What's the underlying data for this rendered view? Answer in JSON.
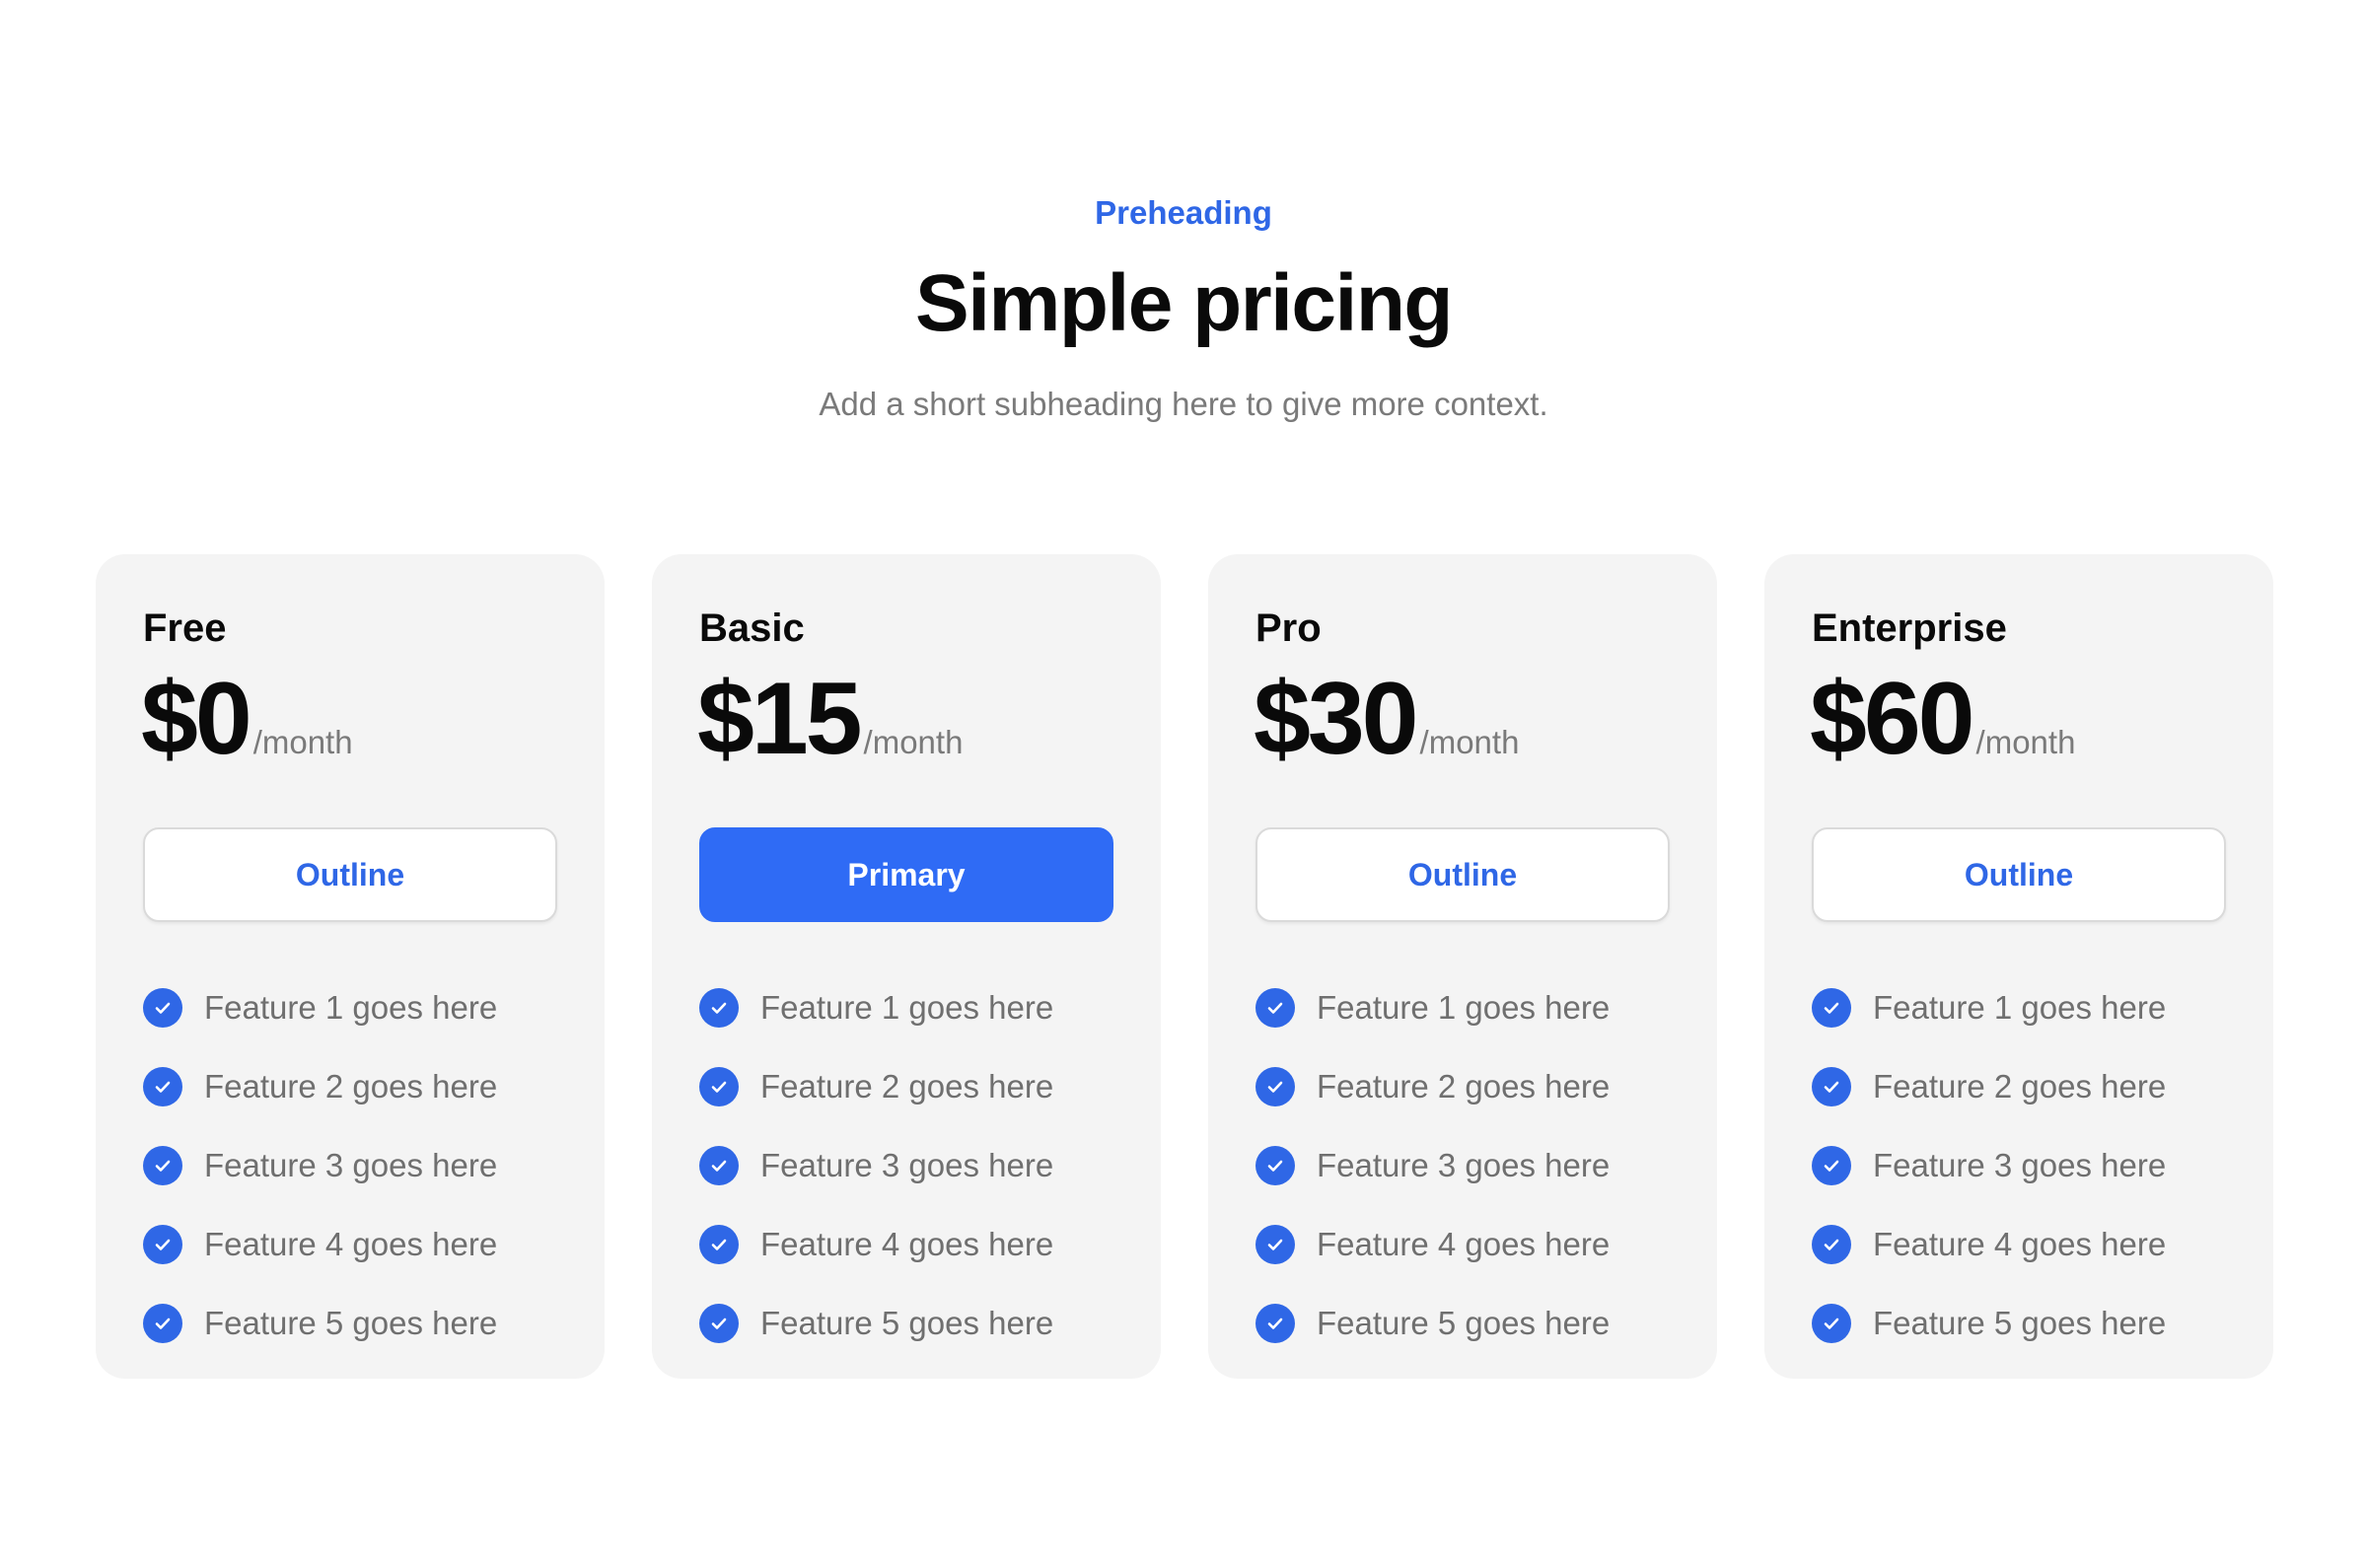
{
  "header": {
    "preheading": "Preheading",
    "title": "Simple pricing",
    "subheading": "Add a short subheading here to give more context."
  },
  "colors": {
    "accent": "#2f67e6",
    "primary_button": "#2f6bf5",
    "card_background": "#f4f4f4",
    "muted_text": "#7a7a7a"
  },
  "plans": [
    {
      "name": "Free",
      "price": "$0",
      "period": "/month",
      "button_label": "Outline",
      "button_style": "outline",
      "features": [
        "Feature 1 goes here",
        "Feature 2 goes here",
        "Feature 3 goes here",
        "Feature 4 goes here",
        "Feature 5 goes here"
      ]
    },
    {
      "name": "Basic",
      "price": "$15",
      "period": "/month",
      "button_label": "Primary",
      "button_style": "primary",
      "features": [
        "Feature 1 goes here",
        "Feature 2 goes here",
        "Feature 3 goes here",
        "Feature 4 goes here",
        "Feature 5 goes here"
      ]
    },
    {
      "name": "Pro",
      "price": "$30",
      "period": "/month",
      "button_label": "Outline",
      "button_style": "outline",
      "features": [
        "Feature 1 goes here",
        "Feature 2 goes here",
        "Feature 3 goes here",
        "Feature 4 goes here",
        "Feature 5 goes here"
      ]
    },
    {
      "name": "Enterprise",
      "price": "$60",
      "period": "/month",
      "button_label": "Outline",
      "button_style": "outline",
      "features": [
        "Feature 1 goes here",
        "Feature 2 goes here",
        "Feature 3 goes here",
        "Feature 4 goes here",
        "Feature 5 goes here"
      ]
    }
  ],
  "icons": {
    "feature_check": "check-circle-icon"
  }
}
